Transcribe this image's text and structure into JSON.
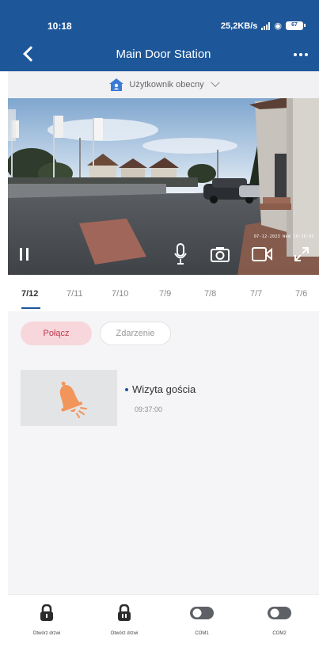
{
  "status_bar": {
    "time": "10:18",
    "network_speed": "25,2KB/s",
    "battery": "67"
  },
  "header": {
    "title": "Main Door Station"
  },
  "user_selector": {
    "label": "Użytkownik obecny"
  },
  "camera": {
    "timestamp": "07-12-2023 Wed 10:18:05"
  },
  "date_tabs": [
    {
      "label": "7/12",
      "active": true
    },
    {
      "label": "7/11",
      "active": false
    },
    {
      "label": "7/10",
      "active": false
    },
    {
      "label": "7/9",
      "active": false
    },
    {
      "label": "7/8",
      "active": false
    },
    {
      "label": "7/7",
      "active": false
    },
    {
      "label": "7/6",
      "active": false
    }
  ],
  "filters": {
    "connect": "Połącz",
    "event": "Zdarzenie"
  },
  "events": [
    {
      "title": "Wizyta gościa",
      "time": "09:37:00",
      "icon": "bell-icon"
    }
  ],
  "bottom_actions": [
    {
      "label": "Otwórz drzwi",
      "icon": "lock-icon"
    },
    {
      "label": "Otwórz drzwi",
      "icon": "lock-icon"
    },
    {
      "label": "COM1",
      "icon": "toggle-icon"
    },
    {
      "label": "COM2",
      "icon": "toggle-icon"
    }
  ],
  "colors": {
    "header": "#1e5799",
    "accent_pill": "#f7d7dc",
    "accent_text": "#c0394d",
    "bell": "#f2955a"
  }
}
